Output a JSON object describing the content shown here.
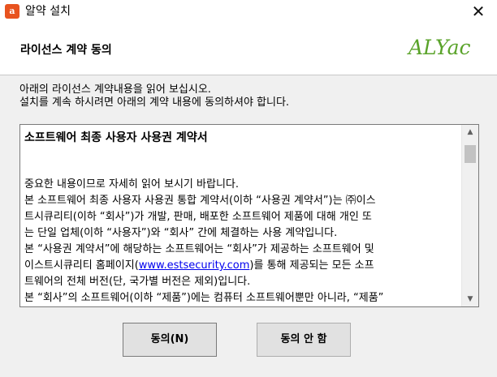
{
  "window": {
    "title": "알약 설치",
    "icon": "alyac-app-icon",
    "close_label": "✕"
  },
  "header": {
    "title": "라이선스 계약 동의",
    "logo": "ALYac",
    "logo_color": "#5aa32a"
  },
  "instructions": {
    "line1": "아래의 라이선스 계약내용을 읽어 보십시오.",
    "line2": "설치를 계속 하시려면 아래의 계약 내용에 동의하셔야 합니다."
  },
  "license": {
    "heading": "소프트웨어 최종 사용자 사용권 계약서",
    "lines": [
      "중요한 내용이므로 자세히 읽어 보시기 바랍니다.",
      "본 소프트웨어 최종 사용자 사용권 통합 계약서(이하 “사용권 계약서”)는 ㈜이스",
      "트시큐리티(이하 “회사”)가 개발, 판매, 배포한 소프트웨어 제품에 대해 개인 또",
      "는 단일 업체(이하 “사용자”)와 “회사” 간에 체결하는 사용 계약입니다.",
      "본 “사용권 계약서”에 해당하는 소프트웨어는 “회사”가 제공하는 소프트웨어 및",
      "이스트시큐리티 홈페이지(",
      ")를 통해 제공되는 모든 소프",
      "트웨어의 전체 버전(단, 국가별 버전은 제외)입니다.",
      "본 “회사”의 소프트웨어(이하 “제품”)에는 컴퓨터 소프트웨어뿐만 아니라, “제품”"
    ],
    "link": "www.estsecurity.com"
  },
  "buttons": {
    "agree": "동의(N)",
    "disagree": "동의 안 함"
  }
}
